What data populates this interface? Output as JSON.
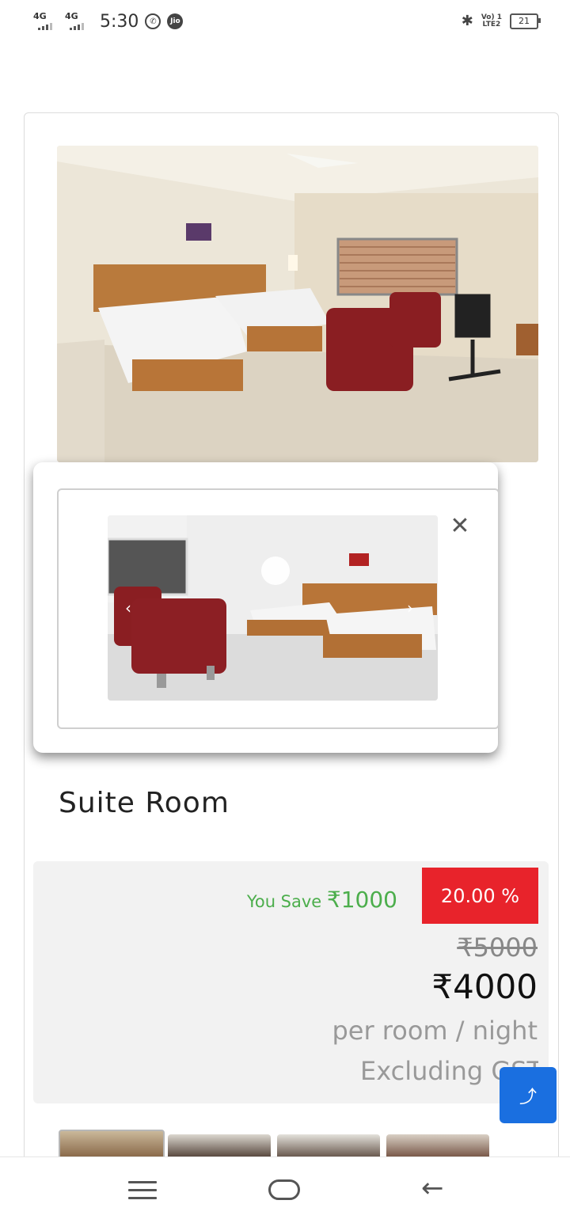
{
  "status_bar": {
    "network1": "4G",
    "network2": "4G",
    "time": "5:30",
    "jio": "Jio",
    "volte": "Vo) 1",
    "lte": "LTE2",
    "battery": "21"
  },
  "room": {
    "title": "Suite Room"
  },
  "pricing": {
    "you_save_label": "You Save",
    "you_save_amount": "₹1000",
    "discount": "20.00 %",
    "original_price": "₹5000",
    "price": "₹4000",
    "per_room": "per room / night",
    "tax_note": "Excluding GST"
  },
  "popup": {
    "close": "✕",
    "prev": "‹",
    "next": "›"
  },
  "scroll_top_icon": "⤴",
  "nav": {
    "back": "←"
  },
  "colors": {
    "save_green": "#4cae4c",
    "discount_red": "#e8232b",
    "scroll_button_blue": "#1a6fe0"
  }
}
